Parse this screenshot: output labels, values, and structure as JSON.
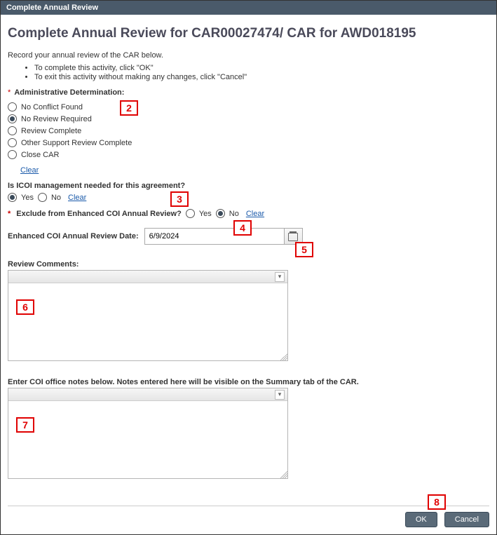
{
  "window": {
    "title": "Complete Annual Review"
  },
  "heading": "Complete Annual Review for  CAR00027474/ CAR for AWD018195",
  "subhead": "Record your annual review of the CAR below.",
  "instructions": [
    "To complete this activity, click \"OK\"",
    "To exit this activity without making any changes, click \"Cancel\""
  ],
  "admin": {
    "label": "Administrative Determination:",
    "options": [
      "No Conflict Found",
      "No Review Required",
      "Review Complete",
      "Other Support Review Complete",
      "Close CAR"
    ],
    "selected": "No Review Required",
    "clear": "Clear"
  },
  "icoi": {
    "label": "Is ICOI management needed for this agreement?",
    "yes": "Yes",
    "no": "No",
    "selected": "Yes",
    "clear": "Clear"
  },
  "exclude": {
    "label": "Exclude from Enhanced COI Annual Review?",
    "yes": "Yes",
    "no": "No",
    "selected": "No",
    "clear": "Clear"
  },
  "date": {
    "label": "Enhanced COI Annual Review Date:",
    "value": "6/9/2024"
  },
  "review_comments": {
    "label": "Review Comments:"
  },
  "office_notes": {
    "label": "Enter COI office notes below. Notes entered here will be visible on the Summary tab of the CAR."
  },
  "buttons": {
    "ok": "OK",
    "cancel": "Cancel"
  },
  "callouts": {
    "c2": "2",
    "c3": "3",
    "c4": "4",
    "c5": "5",
    "c6": "6",
    "c7": "7",
    "c8": "8"
  }
}
